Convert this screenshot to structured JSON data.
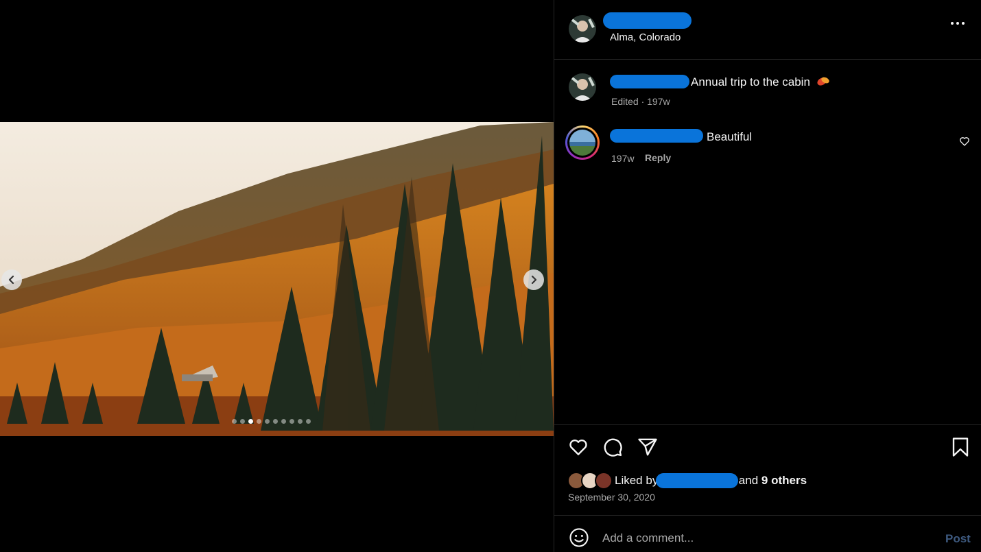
{
  "post": {
    "location": "Alma, Colorado",
    "caption": "Annual trip to the cabin",
    "caption_meta": "Edited · 197w",
    "carousel_total": 10,
    "carousel_active": 2
  },
  "comment": {
    "text": "Beautiful",
    "age": "197w",
    "reply_label": "Reply"
  },
  "likes": {
    "prefix": "Liked by",
    "middle": "and",
    "others": "9 others"
  },
  "date": "September 30, 2020",
  "composer": {
    "placeholder": "Add a comment...",
    "post_label": "Post"
  },
  "colors": {
    "redaction": "#0a74da",
    "background": "#000000",
    "muted": "#a8a8a8",
    "post_disabled": "#3e5a80"
  }
}
